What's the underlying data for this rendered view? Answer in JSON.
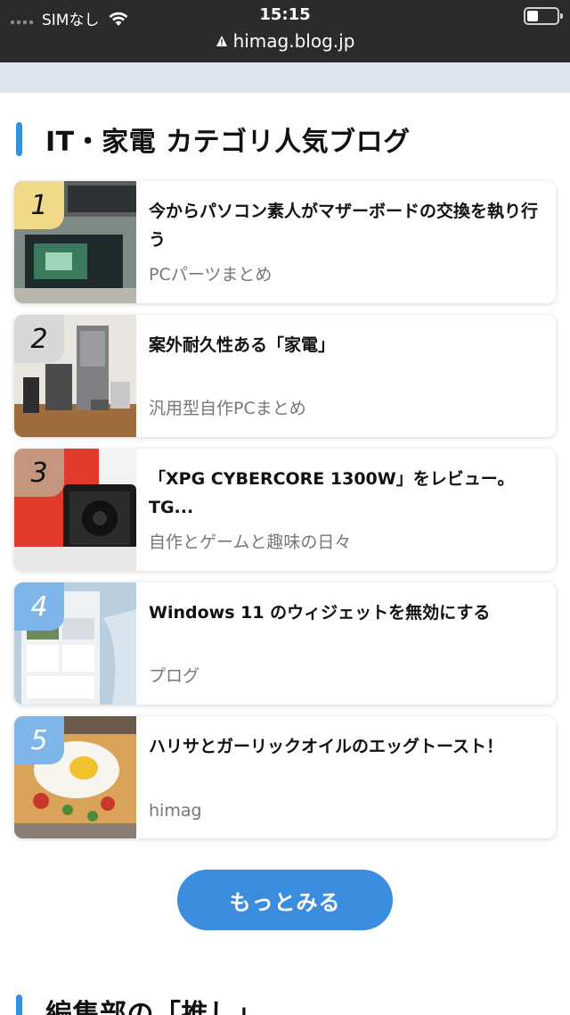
{
  "status_bar": {
    "carrier": "SIMなし",
    "time": "15:15",
    "url": "himag.blog.jp"
  },
  "section": {
    "title": "IT・家電 カテゴリ人気ブログ"
  },
  "rankings": [
    {
      "rank": "1",
      "title": "今からパソコン素人がマザーボードの交換を執り行う",
      "source": "PCパーツまとめ",
      "badge_color": "#f1d98a"
    },
    {
      "rank": "2",
      "title": "案外耐久性ある「家電」",
      "source": "汎用型自作PCまとめ",
      "badge_color": "#d8d8d8"
    },
    {
      "rank": "3",
      "title": "「XPG CYBERCORE 1300W」をレビュー。TG...",
      "source": "自作とゲームと趣味の日々",
      "badge_color": "#c4967e"
    },
    {
      "rank": "4",
      "title": "Windows 11 のウィジェットを無効にする",
      "source": "プログ",
      "badge_color": "#7fb6ea"
    },
    {
      "rank": "5",
      "title": "ハリサとガーリックオイルのエッグトースト！",
      "source": "himag",
      "badge_color": "#7fb6ea"
    }
  ],
  "more_button": {
    "label": "もっとみる"
  },
  "next_section": {
    "title": "編集部の「推し」"
  },
  "colors": {
    "accent": "#3b8de0",
    "status_bar": "#2b2b2d"
  }
}
